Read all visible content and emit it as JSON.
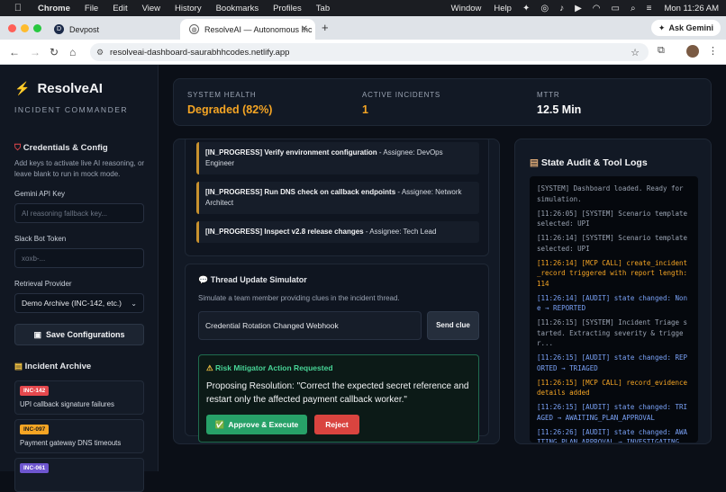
{
  "menubar": {
    "app": "Chrome",
    "items": [
      "File",
      "Edit",
      "View",
      "History",
      "Bookmarks",
      "Profiles",
      "Tab"
    ],
    "right_items": [
      "Window",
      "Help"
    ],
    "clock": "Mon 11:26 AM"
  },
  "browser": {
    "tabs": [
      {
        "title": "Devpost"
      },
      {
        "title": "ResolveAI — Autonomous Inc"
      }
    ],
    "ask_gemini": "Ask Gemini",
    "url": "resolveai-dashboard-saurabhhcodes.netlify.app"
  },
  "sidebar": {
    "brand": "ResolveAI",
    "brand_sub": "INCIDENT COMMANDER",
    "credentials_title": "Credentials & Config",
    "credentials_desc": "Add keys to activate live AI reasoning, or leave blank to run in mock mode.",
    "gemini_label": "Gemini API Key",
    "gemini_placeholder": "AI reasoning fallback key...",
    "slack_label": "Slack Bot Token",
    "slack_placeholder": "xoxb-...",
    "retrieval_label": "Retrieval Provider",
    "retrieval_value": "Demo Archive (INC-142, etc.)",
    "save_label": "Save Configurations",
    "archive_title": "Incident Archive",
    "archive": [
      {
        "id": "INC-142",
        "title": "UPI callback signature failures",
        "color": "#e5484d"
      },
      {
        "id": "INC-097",
        "title": "Payment gateway DNS timeouts",
        "color": "#f5a524"
      },
      {
        "id": "INC-061",
        "title": "",
        "color": "#6e56cf"
      }
    ]
  },
  "metrics": {
    "health_label": "SYSTEM HEALTH",
    "health_value": "Degraded (82%)",
    "incidents_label": "ACTIVE INCIDENTS",
    "incidents_value": "1",
    "mttr_label": "MTTR",
    "mttr_value": "12.5 Min"
  },
  "tasks": [
    {
      "status": "[IN_PROGRESS] Verify environment configuration",
      "assignee": " - Assignee: DevOps Engineer"
    },
    {
      "status": "[IN_PROGRESS] Run DNS check on callback endpoints",
      "assignee": " - Assignee: Network Architect"
    },
    {
      "status": "[IN_PROGRESS] Inspect v2.8 release changes",
      "assignee": " - Assignee: Tech Lead"
    }
  ],
  "thread": {
    "title": "Thread Update Simulator",
    "desc": "Simulate a team member providing clues in the incident thread.",
    "input_value": "Credential Rotation Changed Webhook",
    "send_label": "Send clue"
  },
  "mitigator": {
    "title": "Risk Mitigator Action Requested",
    "body": "Proposing Resolution: \"Correct the expected secret reference and restart only the affected payment callback worker.\"",
    "approve_label": "Approve & Execute",
    "reject_label": "Reject"
  },
  "audit": {
    "title": "State Audit & Tool Logs",
    "logs": [
      {
        "text": "[SYSTEM] Dashboard loaded. Ready for simulation.",
        "color": "#9aa3b2"
      },
      {
        "text": "[11:26:05] [SYSTEM] Scenario template selected: UPI",
        "color": "#9aa3b2"
      },
      {
        "text": "[11:26:14] [SYSTEM] Scenario template selected: UPI",
        "color": "#9aa3b2"
      },
      {
        "text": "[11:26:14] [MCP CALL] create_incident_record triggered with report length: 114",
        "color": "#f5a524"
      },
      {
        "text": "[11:26:14] [AUDIT] state changed: None → REPORTED",
        "color": "#7aa2f7"
      },
      {
        "text": "[11:26:15] [SYSTEM] Incident Triage started. Extracting severity & trigger...",
        "color": "#9aa3b2"
      },
      {
        "text": "[11:26:15] [AUDIT] state changed: REPORTED → TRIAGED",
        "color": "#7aa2f7"
      },
      {
        "text": "[11:26:15] [MCP CALL] record_evidence details added",
        "color": "#f5a524"
      },
      {
        "text": "[11:26:15] [AUDIT] state changed: TRIAGED → AWAITING_PLAN_APPROVAL",
        "color": "#7aa2f7"
      },
      {
        "text": "[11:26:26] [AUDIT] state changed: AWAITING_PLAN_APPROVAL → INVESTIGATING",
        "color": "#7aa2f7"
      }
    ]
  },
  "colors": {
    "health": "#f5a524",
    "incidents": "#f5a524",
    "accent_green": "#48d597"
  }
}
